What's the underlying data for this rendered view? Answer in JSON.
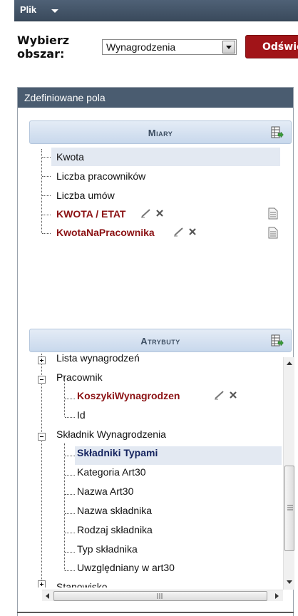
{
  "menu": {
    "file_label": "Plik"
  },
  "area": {
    "label": "Wybierz\nobszar:",
    "selected": "Wynagrodzenia",
    "refresh_label": "Odśwież"
  },
  "fields": {
    "header": "Zdefiniowane pola",
    "measures": {
      "title": "Miary",
      "items": [
        {
          "label": "Kwota",
          "selected": true
        },
        {
          "label": "Liczba pracowników"
        },
        {
          "label": "Liczba umów"
        },
        {
          "label": "KWOTA / ETAT",
          "calculated": true
        },
        {
          "label": "KwotaNaPracownika",
          "calculated": true
        }
      ]
    },
    "attributes": {
      "title": "Atrybuty",
      "items": [
        {
          "label": "Lista wynagrodzeń",
          "expander": "plus"
        },
        {
          "label": "Pracownik",
          "expander": "minus"
        },
        {
          "label": "KoszykiWynagrodzen",
          "calculated": true
        },
        {
          "label": "Id"
        },
        {
          "label": "Składnik Wynagrodzenia",
          "expander": "minus"
        },
        {
          "label": "Składniki Typami",
          "highlighted": true
        },
        {
          "label": "Kategoria Art30"
        },
        {
          "label": "Nazwa Art30"
        },
        {
          "label": "Nazwa składnika"
        },
        {
          "label": "Rodzaj składnika"
        },
        {
          "label": "Typ składnika"
        },
        {
          "label": "Uwzględniany w art30"
        },
        {
          "label": "Stanowisko",
          "expander": "plus"
        }
      ]
    }
  },
  "colors": {
    "menubar": "#4a5c70",
    "calculated": "#8b1113",
    "highlight": "#14235e",
    "refresh": "#a11418"
  }
}
